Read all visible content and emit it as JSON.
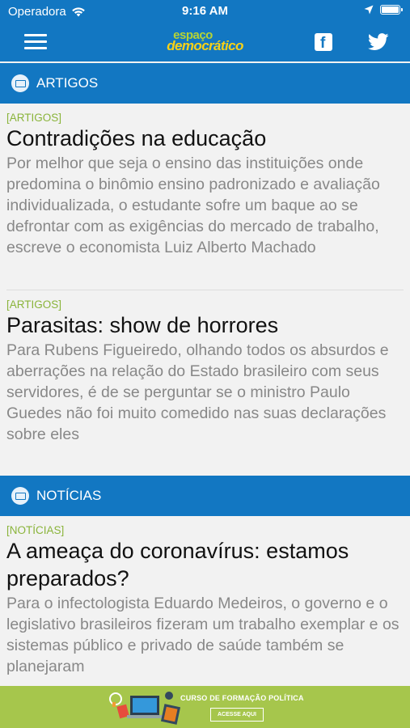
{
  "status_bar": {
    "carrier": "Operadora",
    "time": "9:16 AM",
    "battery_level": 1.0
  },
  "header": {
    "logo_line1": "espaço",
    "logo_line2": "democrático",
    "menu_icon": "hamburger-menu-icon",
    "facebook_icon": "facebook-icon",
    "twitter_icon": "twitter-icon"
  },
  "sections": [
    {
      "title": "ARTIGOS",
      "icon": "section-book-icon",
      "articles": [
        {
          "tag": "[ARTIGOS]",
          "title": "Contradições na educação",
          "excerpt": "Por melhor que seja o ensino das instituições onde predomina o binômio ensino padronizado e avaliação individualizada, o estudante sofre um baque ao se defrontar com as exigências do mercado de trabalho, escreve o economista Luiz Alberto Machado"
        },
        {
          "tag": "[ARTIGOS]",
          "title": "Parasitas: show de horrores",
          "excerpt": "Para Rubens Figueiredo, olhando todos os absurdos e aberrações na relação do Estado brasileiro com seus servidores, é de se perguntar se o ministro Paulo Guedes não foi muito comedido nas suas declarações sobre eles"
        }
      ]
    },
    {
      "title": "NOTÍCIAS",
      "icon": "section-book-icon",
      "articles": [
        {
          "tag": "[NOTÍCIAS]",
          "title": "A ameaça do coronavírus: estamos preparados?",
          "excerpt": "Para o infectologista Eduardo Medeiros, o governo e o legislativo brasileiros fizeram um trabalho exemplar e os sistemas público e privado de saúde também se planejaram"
        }
      ]
    }
  ],
  "ad": {
    "text": "CURSO DE FORMAÇÃO POLÍTICA",
    "button": "ACESSE AQUI",
    "background": "#a6c64c"
  },
  "colors": {
    "primary": "#1277c2",
    "tag": "#8ab43a",
    "excerpt": "#888888",
    "logo_green": "#b5d335",
    "logo_yellow": "#f7d117"
  }
}
